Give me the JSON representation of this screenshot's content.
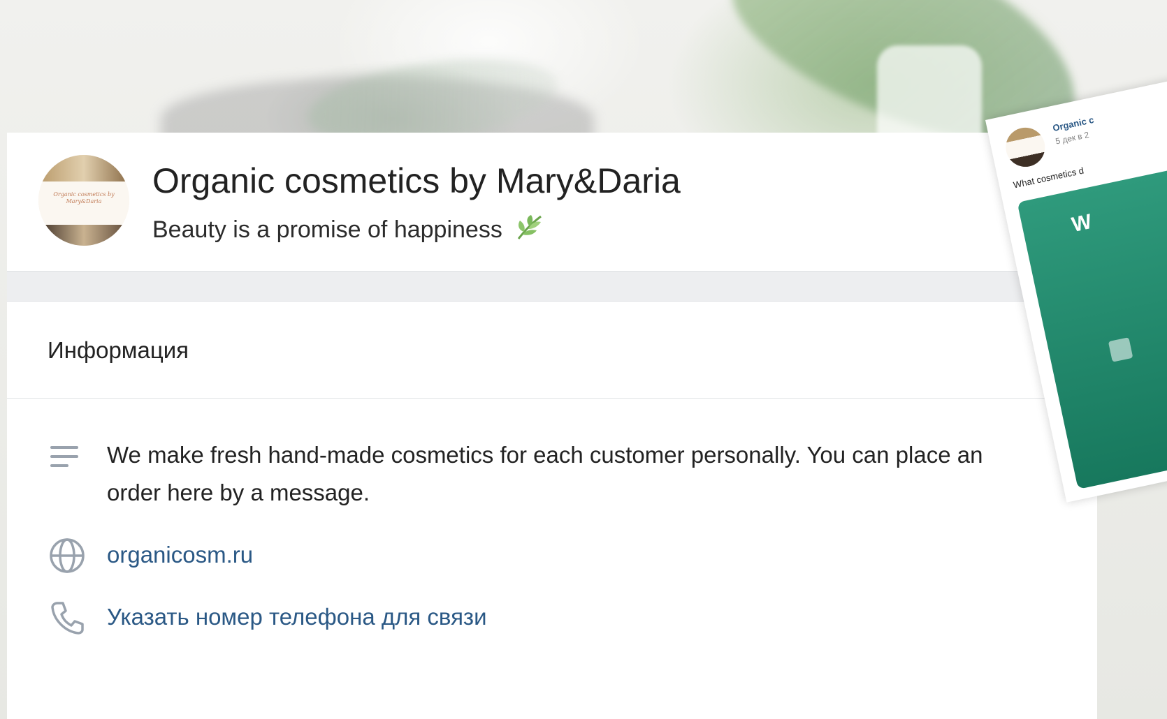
{
  "group": {
    "name": "Organic cosmetics by Mary&Daria",
    "status": "Beauty is a promise of happiness",
    "avatar_text": "Organic cosmetics by Mary&Daria"
  },
  "info": {
    "section_title": "Информация",
    "description": "We make fresh hand-made cosmetics for each customer personally. You can place an order here by a message.",
    "website": "organicosm.ru",
    "phone_prompt": "Указать номер телефона для связи"
  },
  "post_preview": {
    "author": "Organic c",
    "date": "5 дек в 2",
    "text": "What cosmetics d",
    "image_text": "W"
  },
  "colors": {
    "link": "#2a5885",
    "icon": "#99a2ad",
    "accent_green": "#2f9a7c"
  },
  "icons": {
    "description": "text-lines-icon",
    "website": "globe-icon",
    "phone": "phone-icon",
    "status": "leaf-icon"
  }
}
